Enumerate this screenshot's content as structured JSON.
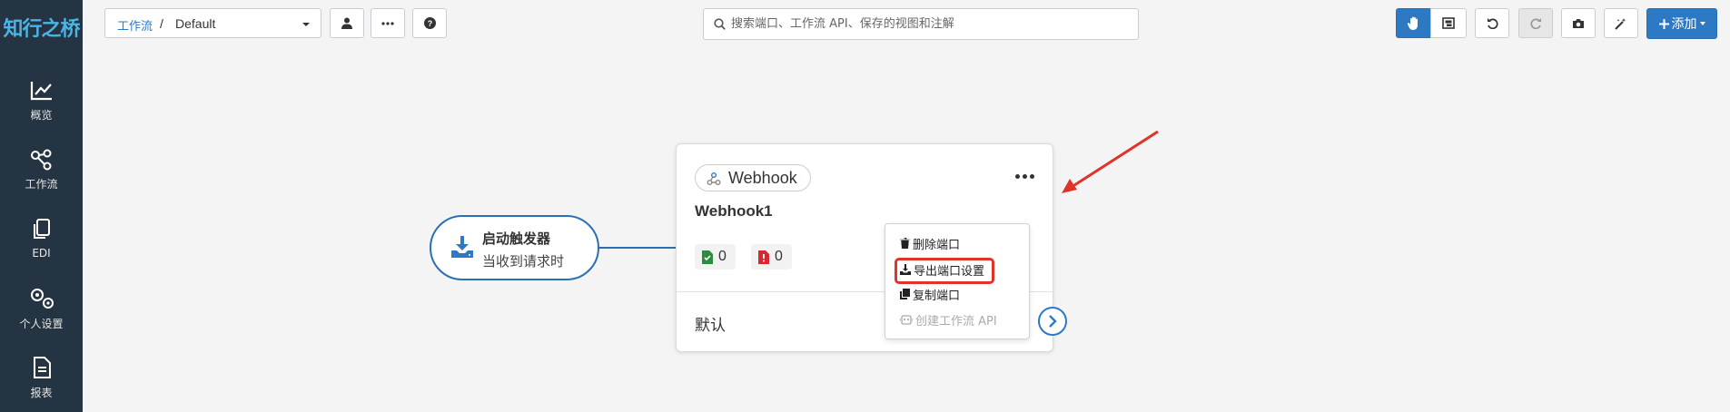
{
  "brand": {
    "logo_text": "知行之桥",
    "logo_color": "#4ab4e6"
  },
  "sidebar": {
    "items": [
      {
        "label": "概览",
        "icon": "chart-line-icon"
      },
      {
        "label": "工作流",
        "icon": "share-nodes-icon"
      },
      {
        "label": "EDI",
        "icon": "copy-icon"
      },
      {
        "label": "个人设置",
        "icon": "gears-icon"
      },
      {
        "label": "报表",
        "icon": "file-lines-icon"
      }
    ]
  },
  "toolbar": {
    "breadcrumb_link": "工作流",
    "breadcrumb_sep": "/",
    "breadcrumb_current": "Default",
    "search_placeholder": "搜索端口、工作流 API、保存的视图和注解",
    "add_label": "添加"
  },
  "canvas": {
    "trigger_title": "启动触发器",
    "trigger_subtitle": "当收到请求时",
    "card_type": "Webhook",
    "card_name": "Webhook1",
    "success_count": "0",
    "error_count": "0",
    "footer_label": "默认"
  },
  "menu": {
    "items": [
      {
        "label": "删除端口",
        "icon": "trash-icon",
        "disabled": false
      },
      {
        "label": "导出端口设置",
        "icon": "download-icon",
        "disabled": false
      },
      {
        "label": "复制端口",
        "icon": "copy-icon",
        "disabled": false
      },
      {
        "label": "创建工作流 API",
        "icon": "robot-icon",
        "disabled": true
      }
    ]
  },
  "colors": {
    "accent": "#2e79c4",
    "sidebar_bg": "#243442",
    "highlight": "#e0342a",
    "success": "#2e8b3d",
    "error": "#d8282f"
  }
}
